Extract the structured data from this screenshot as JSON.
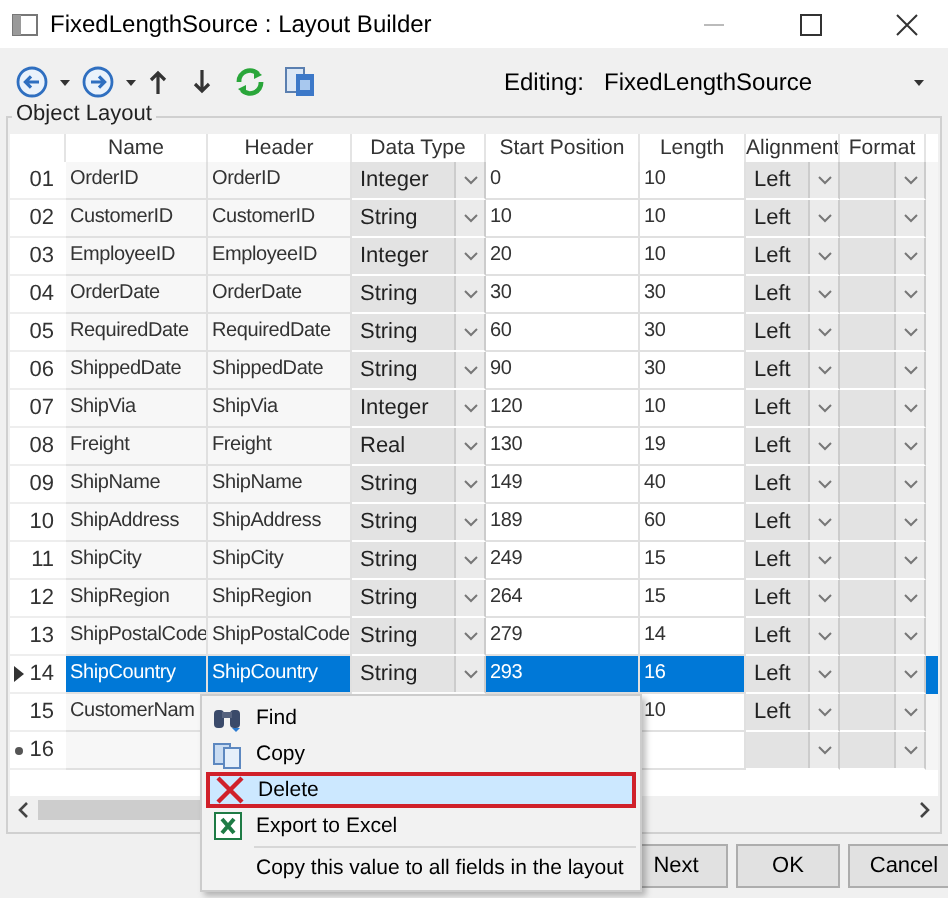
{
  "window": {
    "title": "FixedLengthSource : Layout Builder"
  },
  "toolbar": {
    "editing_label": "Editing:",
    "editing_value": "FixedLengthSource"
  },
  "group": {
    "title": "Object Layout"
  },
  "table": {
    "columns": [
      "Name",
      "Header",
      "Data Type",
      "Start Position",
      "Length",
      "Alignment",
      "Format"
    ],
    "rows": [
      {
        "number": "01",
        "name": "OrderID",
        "header": "OrderID",
        "data_type": "Integer",
        "start": "0",
        "length": "10",
        "alignment": "Left",
        "selected": false
      },
      {
        "number": "02",
        "name": "CustomerID",
        "header": "CustomerID",
        "data_type": "String",
        "start": "10",
        "length": "10",
        "alignment": "Left",
        "selected": false
      },
      {
        "number": "03",
        "name": "EmployeeID",
        "header": "EmployeeID",
        "data_type": "Integer",
        "start": "20",
        "length": "10",
        "alignment": "Left",
        "selected": false
      },
      {
        "number": "04",
        "name": "OrderDate",
        "header": "OrderDate",
        "data_type": "String",
        "start": "30",
        "length": "30",
        "alignment": "Left",
        "selected": false
      },
      {
        "number": "05",
        "name": "RequiredDate",
        "header": "RequiredDate",
        "data_type": "String",
        "start": "60",
        "length": "30",
        "alignment": "Left",
        "selected": false
      },
      {
        "number": "06",
        "name": "ShippedDate",
        "header": "ShippedDate",
        "data_type": "String",
        "start": "90",
        "length": "30",
        "alignment": "Left",
        "selected": false
      },
      {
        "number": "07",
        "name": "ShipVia",
        "header": "ShipVia",
        "data_type": "Integer",
        "start": "120",
        "length": "10",
        "alignment": "Left",
        "selected": false
      },
      {
        "number": "08",
        "name": "Freight",
        "header": "Freight",
        "data_type": "Real",
        "start": "130",
        "length": "19",
        "alignment": "Left",
        "selected": false
      },
      {
        "number": "09",
        "name": "ShipName",
        "header": "ShipName",
        "data_type": "String",
        "start": "149",
        "length": "40",
        "alignment": "Left",
        "selected": false
      },
      {
        "number": "10",
        "name": "ShipAddress",
        "header": "ShipAddress",
        "data_type": "String",
        "start": "189",
        "length": "60",
        "alignment": "Left",
        "selected": false
      },
      {
        "number": "11",
        "name": "ShipCity",
        "header": "ShipCity",
        "data_type": "String",
        "start": "249",
        "length": "15",
        "alignment": "Left",
        "selected": false
      },
      {
        "number": "12",
        "name": "ShipRegion",
        "header": "ShipRegion",
        "data_type": "String",
        "start": "264",
        "length": "15",
        "alignment": "Left",
        "selected": false
      },
      {
        "number": "13",
        "name": "ShipPostalCode",
        "header": "ShipPostalCode",
        "data_type": "String",
        "start": "279",
        "length": "14",
        "alignment": "Left",
        "selected": false
      },
      {
        "number": "14",
        "kind": "current",
        "name": "ShipCountry",
        "header": "ShipCountry",
        "data_type": "String",
        "start": "293",
        "length": "16",
        "alignment": "Left",
        "selected": true
      },
      {
        "number": "15",
        "name": "CustomerNam",
        "length": "10",
        "alignment": "Left",
        "selected": false
      },
      {
        "number": "16",
        "kind": "new",
        "selected": false
      }
    ]
  },
  "context_menu": {
    "items": [
      {
        "label": "Find",
        "kind": "find",
        "selected": false
      },
      {
        "label": "Copy",
        "kind": "copy",
        "selected": false
      },
      {
        "label": "Delete",
        "kind": "delete",
        "selected": true
      },
      {
        "label": "Export to Excel",
        "kind": "excel",
        "selected": false
      },
      {
        "label": "Copy this value to all fields in the layout",
        "separator_before": true,
        "selected": false
      }
    ]
  },
  "buttons": [
    {
      "label": "Next"
    },
    {
      "label": "OK"
    },
    {
      "label": "Cancel"
    }
  ]
}
